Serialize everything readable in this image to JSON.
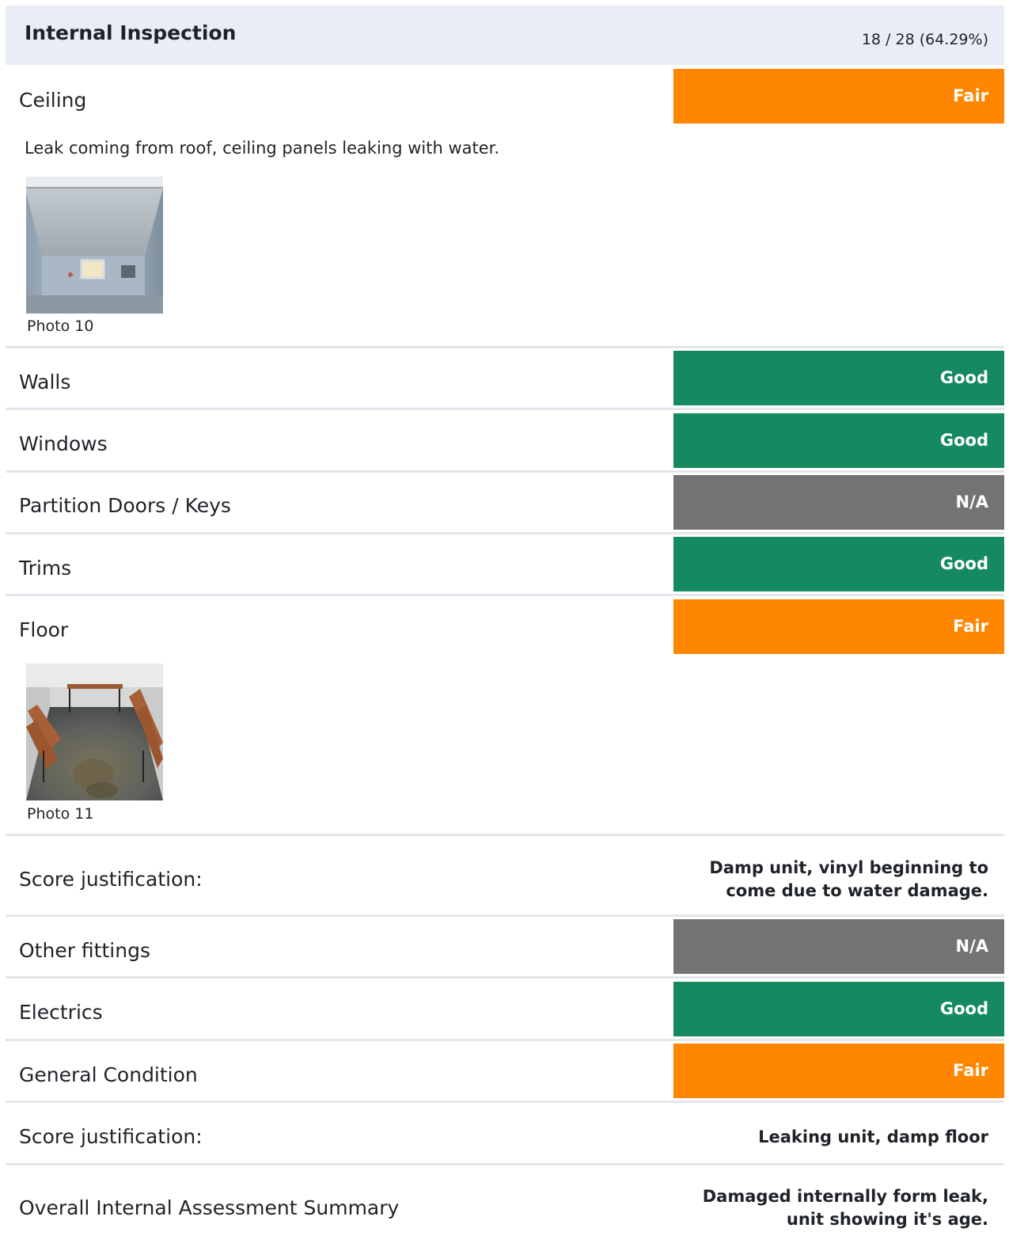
{
  "section": {
    "title": "Internal Inspection",
    "score": "18 / 28 (64.29%)"
  },
  "items": {
    "ceiling": {
      "label": "Ceiling",
      "rating": "Fair",
      "note": "Leak coming from roof, ceiling panels leaking with water.",
      "photo_caption": "Photo 10"
    },
    "walls": {
      "label": "Walls",
      "rating": "Good"
    },
    "windows": {
      "label": "Windows",
      "rating": "Good"
    },
    "partition": {
      "label": "Partition Doors / Keys",
      "rating": "N/A"
    },
    "trims": {
      "label": "Trims",
      "rating": "Good"
    },
    "floor": {
      "label": "Floor",
      "rating": "Fair",
      "photo_caption": "Photo 11"
    },
    "floor_justification": {
      "label": "Score justification:",
      "text_line1": "Damp unit, vinyl beginning to",
      "text_line2": "come due to water damage."
    },
    "other_fittings": {
      "label": "Other fittings",
      "rating": "N/A"
    },
    "electrics": {
      "label": "Electrics",
      "rating": "Good"
    },
    "general_condition": {
      "label": "General Condition",
      "rating": "Fair"
    },
    "general_justification": {
      "label": "Score justification:",
      "text": "Leaking unit, damp floor"
    },
    "overall_summary": {
      "label": "Overall Internal Assessment Summary",
      "text_line1": "Damaged internally form leak,",
      "text_line2": "unit showing it's age."
    }
  },
  "colors": {
    "fair": "#ff8600",
    "good": "#158a61",
    "na": "#737373",
    "header_bg": "#e9edf5",
    "divider": "#e3e6ec"
  }
}
